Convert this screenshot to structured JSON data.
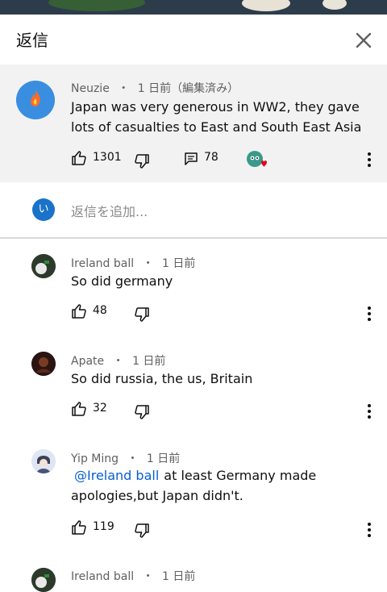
{
  "header": {
    "title": "返信"
  },
  "parent_comment": {
    "author": "Neuzie",
    "time": "1 日前（編集済み）",
    "text": "Japan was very generous in WW2, they gave lots of casualties to East and South East Asia",
    "likes": "1301",
    "replies_count": "78"
  },
  "reply_box": {
    "avatar_letter": "い",
    "placeholder": "返信を追加..."
  },
  "replies": [
    {
      "author": "Ireland ball",
      "time": "1 日前",
      "text": "So did germany",
      "likes": "48"
    },
    {
      "author": "Apate",
      "time": "1 日前",
      "text": "So did russia, the us, Britain",
      "likes": "32"
    },
    {
      "author": "Yip Ming",
      "time": "1 日前",
      "mention": "@Ireland ball",
      "text": "at least Germany made apologies,but Japan didn't.",
      "likes": "119"
    },
    {
      "author": "Ireland ball",
      "time": "1 日前"
    }
  ],
  "separator": "・",
  "colors": {
    "accent_blue": "#065fd4",
    "parent_bg": "#f2f2f2",
    "heart": "#e0001b"
  }
}
